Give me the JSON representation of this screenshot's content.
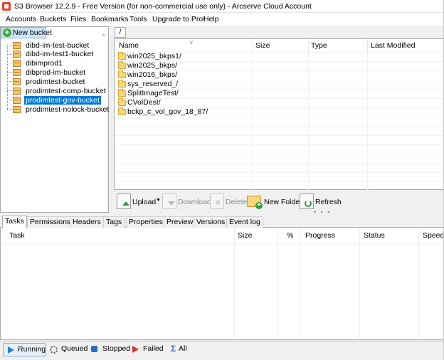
{
  "window": {
    "title": "S3 Browser 12.2.9 - Free Version (for non-commercial use only) - Arcserve Cloud Account",
    "app_icon": "s3-browser-icon"
  },
  "menu": [
    "Accounts",
    "Buckets",
    "Files",
    "Bookmarks",
    "Tools",
    "Upgrade to Pro!",
    "Help"
  ],
  "left_panel": {
    "new_bucket_label": "New bucket",
    "buckets": [
      {
        "name": "dibd-im-test-bucket",
        "selected": false
      },
      {
        "name": "dibd-im-test1-bucket",
        "selected": false
      },
      {
        "name": "dibimprod1",
        "selected": false
      },
      {
        "name": "dibprod-im-bucket",
        "selected": false
      },
      {
        "name": "prodimtest-bucket",
        "selected": false
      },
      {
        "name": "prodimtest-comp-bucket",
        "selected": false
      },
      {
        "name": "prodimtest-gov-bucket",
        "selected": true
      },
      {
        "name": "prodimtest-nolock-bucket",
        "selected": false
      }
    ]
  },
  "path_tab": "/",
  "file_list": {
    "columns": [
      "Name",
      "Size",
      "Type",
      "Last Modified"
    ],
    "rows": [
      {
        "name": "win2025_bkps1/"
      },
      {
        "name": "win2025_bkps/"
      },
      {
        "name": "win2016_bkps/"
      },
      {
        "name": "sys_reserved_/"
      },
      {
        "name": "SplitImageTest/"
      },
      {
        "name": "CVolDest/"
      },
      {
        "name": "bckp_c_vol_gov_18_87/"
      }
    ]
  },
  "toolbar": {
    "upload": "Upload",
    "download": "Download",
    "delete": "Delete",
    "new_folder": "New Folder",
    "refresh": "Refresh"
  },
  "tabs": [
    "Tasks",
    "Permissions",
    "Headers",
    "Tags",
    "Properties",
    "Preview",
    "Versions",
    "Event log"
  ],
  "active_tab": "Tasks",
  "task_grid": {
    "columns": [
      "Task",
      "Size",
      "%",
      "Progress",
      "Status",
      "Speed"
    ]
  },
  "status_bar": {
    "running": "Running",
    "queued": "Queued",
    "stopped": "Stopped",
    "failed": "Failed",
    "all": "All"
  },
  "colors": {
    "selection": "#0078d7",
    "accent_border": "#7fb2dc",
    "bucket_icon": "#f5c670",
    "folder_icon": "#f8d775"
  }
}
